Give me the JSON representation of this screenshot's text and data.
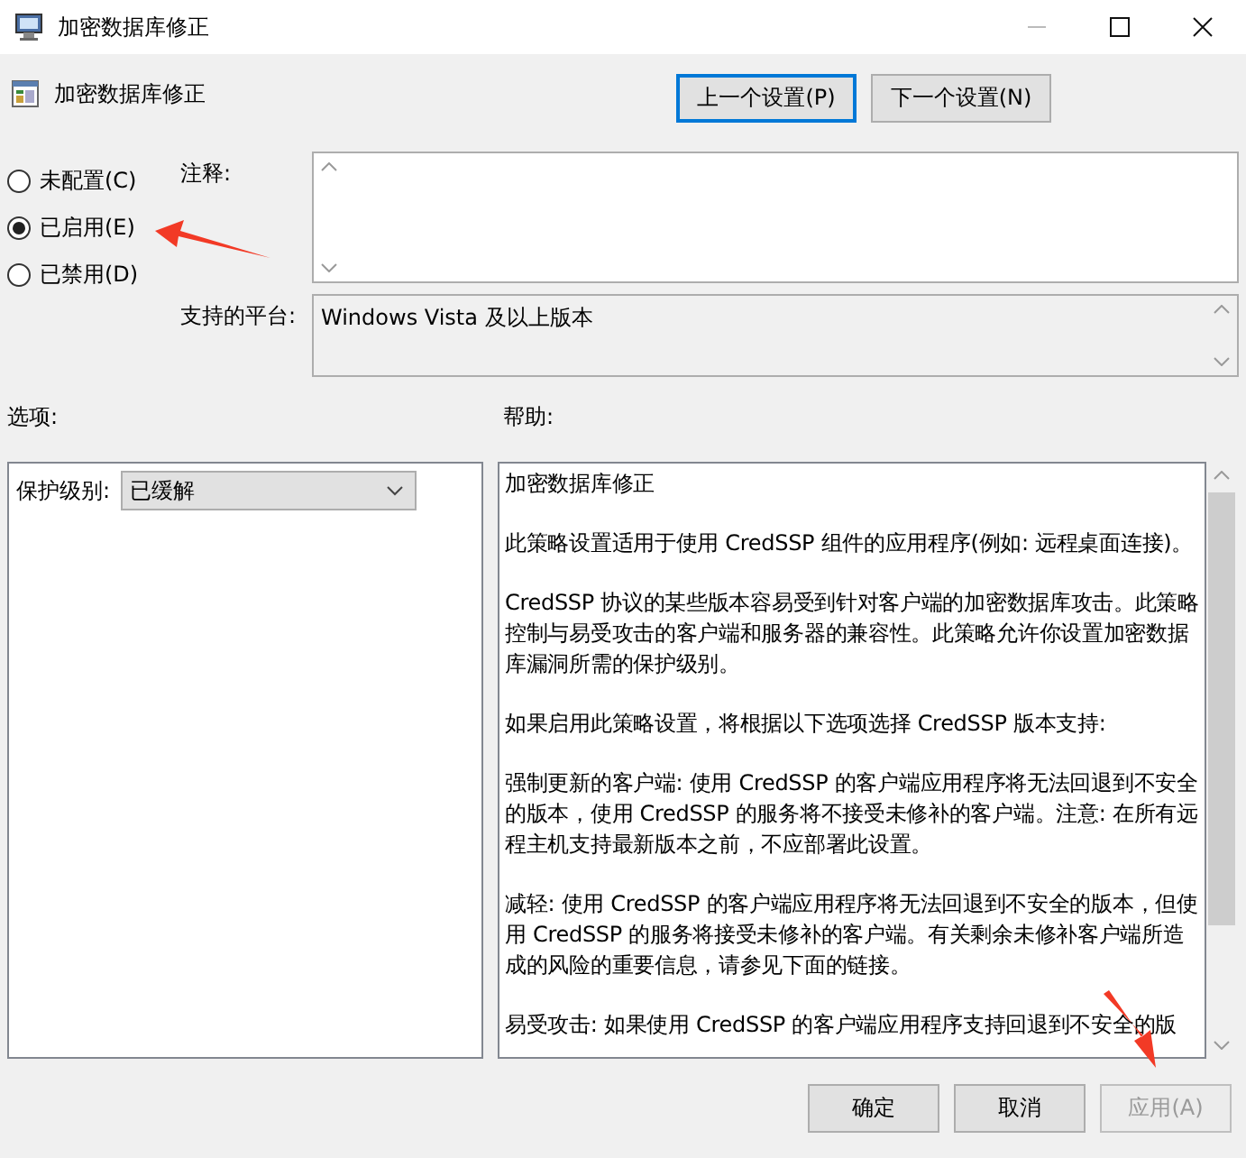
{
  "window": {
    "title": "加密数据库修正"
  },
  "header": {
    "title": "加密数据库修正"
  },
  "nav_buttons": [
    {
      "label": "上一个设置(P)",
      "focused": true
    },
    {
      "label": "下一个设置(N)",
      "focused": false
    }
  ],
  "state_options": [
    {
      "label": "未配置(C)",
      "selected": false
    },
    {
      "label": "已启用(E)",
      "selected": true
    },
    {
      "label": "已禁用(D)",
      "selected": false
    }
  ],
  "comment": {
    "label": "注释:"
  },
  "platform": {
    "label": "支持的平台:",
    "value": "Windows Vista 及以上版本"
  },
  "options": {
    "heading": "选项:",
    "fields": [
      {
        "label": "保护级别:",
        "value": "已缓解"
      }
    ]
  },
  "help": {
    "heading": "帮助:",
    "paragraphs": [
      "加密数据库修正",
      "此策略设置适用于使用 CredSSP 组件的应用程序(例如: 远程桌面连接)。",
      "CredSSP 协议的某些版本容易受到针对客户端的加密数据库攻击。此策略控制与易受攻击的客户端和服务器的兼容性。此策略允许你设置加密数据库漏洞所需的保护级别。",
      "如果启用此策略设置，将根据以下选项选择 CredSSP 版本支持:",
      "强制更新的客户端: 使用 CredSSP 的客户端应用程序将无法回退到不安全的版本，使用 CredSSP 的服务将不接受未修补的客户端。注意: 在所有远程主机支持最新版本之前，不应部署此设置。",
      "减轻: 使用 CredSSP 的客户端应用程序将无法回退到不安全的版本，但使用 CredSSP 的服务将接受未修补的客户端。有关剩余未修补客户端所造成的风险的重要信息，请参见下面的链接。",
      "易受攻击: 如果使用 CredSSP 的客户端应用程序支持回退到不安全的版"
    ]
  },
  "buttons": [
    {
      "label": "确定",
      "disabled": false
    },
    {
      "label": "取消",
      "disabled": false
    },
    {
      "label": "应用(A)",
      "disabled": true
    }
  ]
}
